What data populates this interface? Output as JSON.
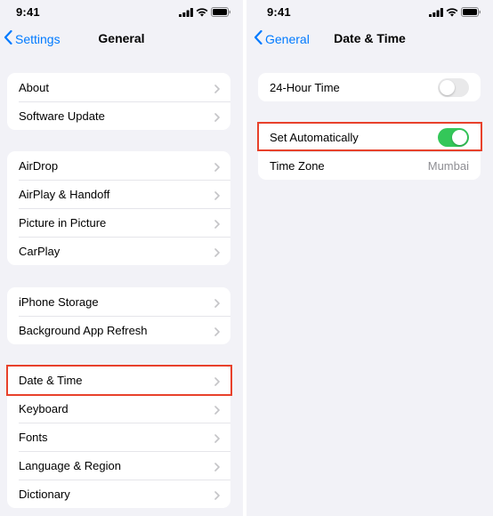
{
  "colors": {
    "accent": "#007aff",
    "toggle_on": "#34c759",
    "highlight": "#e8412b",
    "background": "#f2f2f7"
  },
  "left_screen": {
    "status_time": "9:41",
    "back_label": "Settings",
    "title": "General",
    "groups": [
      [
        "About",
        "Software Update"
      ],
      [
        "AirDrop",
        "AirPlay & Handoff",
        "Picture in Picture",
        "CarPlay"
      ],
      [
        "iPhone Storage",
        "Background App Refresh"
      ],
      [
        "Date & Time",
        "Keyboard",
        "Fonts",
        "Language & Region",
        "Dictionary"
      ]
    ],
    "highlighted_item": "Date & Time"
  },
  "right_screen": {
    "status_time": "9:41",
    "back_label": "General",
    "title": "Date & Time",
    "hour24": {
      "label": "24-Hour Time",
      "on": false
    },
    "set_automatically": {
      "label": "Set Automatically",
      "on": true
    },
    "time_zone": {
      "label": "Time Zone",
      "value": "Mumbai"
    },
    "highlighted_item": "Set Automatically"
  }
}
